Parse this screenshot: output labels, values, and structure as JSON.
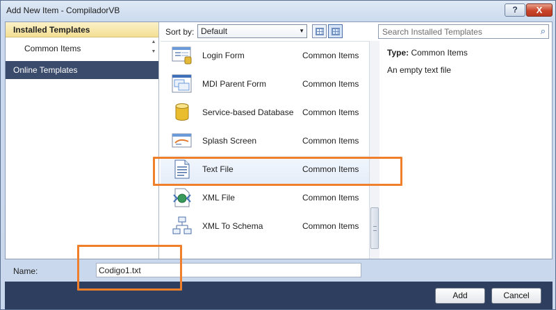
{
  "window": {
    "title": "Add New Item - CompiladorVB"
  },
  "titlebar": {
    "help_label": "?",
    "close_label": "X"
  },
  "left_panel": {
    "installed_label": "Installed Templates",
    "common_label": "Common Items",
    "online_label": "Online Templates"
  },
  "toolbar": {
    "sort_label": "Sort by:",
    "sort_value": "Default",
    "search_placeholder": "Search Installed Templates"
  },
  "templates": [
    {
      "name": "Login Form",
      "category": "Common Items",
      "icon": "login-form-icon"
    },
    {
      "name": "MDI Parent Form",
      "category": "Common Items",
      "icon": "mdi-form-icon"
    },
    {
      "name": "Service-based Database",
      "category": "Common Items",
      "icon": "database-icon"
    },
    {
      "name": "Splash Screen",
      "category": "Common Items",
      "icon": "splash-screen-icon"
    },
    {
      "name": "Text File",
      "category": "Common Items",
      "icon": "text-file-icon",
      "selected": true
    },
    {
      "name": "XML File",
      "category": "Common Items",
      "icon": "xml-file-icon"
    },
    {
      "name": "XML To Schema",
      "category": "Common Items",
      "icon": "xml-schema-icon"
    }
  ],
  "info": {
    "type_label": "Type:",
    "type_value": "Common Items",
    "description": "An empty text file"
  },
  "name_field": {
    "label": "Name:",
    "value": "Codigo1.txt"
  },
  "buttons": {
    "add": "Add",
    "cancel": "Cancel"
  },
  "colors": {
    "highlight": "#f07f2b",
    "selected_header": "#f3df92",
    "online_bg": "#3b4b6c",
    "bottom_bar": "#2e3e5f"
  }
}
